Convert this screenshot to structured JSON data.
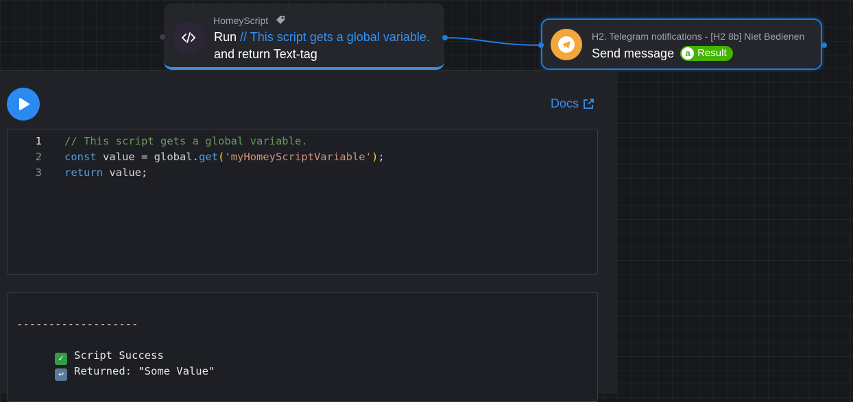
{
  "homeyscript_node": {
    "app_name": "HomeyScript",
    "run_label": "Run",
    "script_name": "// This script gets a global variable.",
    "suffix": "and return Text-tag",
    "icon": "code-icon",
    "tag_icon": "tag-icon"
  },
  "telegram_node": {
    "app_name": "H2. Telegram notifications - [H2 8b] Niet Bedienen",
    "action": "Send message",
    "token_label": "Result",
    "token_icon_letter": "a",
    "icon": "telegram-send-icon",
    "icon_color": "#f2a63b",
    "token_color": "#43b400"
  },
  "editor": {
    "run_button_icon": "play-icon",
    "docs_label": "Docs",
    "docs_icon": "external-link-icon",
    "lines": [
      {
        "number": "1",
        "parts": [
          {
            "cls": "c-com",
            "text": "// This script gets a global variable."
          }
        ]
      },
      {
        "number": "2",
        "parts": [
          {
            "cls": "c-kw",
            "text": "const"
          },
          {
            "cls": "",
            "text": " value = global."
          },
          {
            "cls": "c-fn",
            "text": "get"
          },
          {
            "cls": "c-par",
            "text": "("
          },
          {
            "cls": "c-str",
            "text": "'myHomeyScriptVariable'"
          },
          {
            "cls": "c-par",
            "text": ")"
          },
          {
            "cls": "",
            "text": ";"
          }
        ]
      },
      {
        "number": "3",
        "parts": [
          {
            "cls": "c-kw",
            "text": "return"
          },
          {
            "cls": "",
            "text": " value;"
          }
        ]
      }
    ]
  },
  "output": {
    "separator": "-------------------",
    "success_text": "Script Success",
    "success_icon": "check-mark-icon",
    "returned_text": "Returned: \"Some Value\"",
    "returned_icon": "return-arrow-icon",
    "accent": "#3393f5"
  }
}
